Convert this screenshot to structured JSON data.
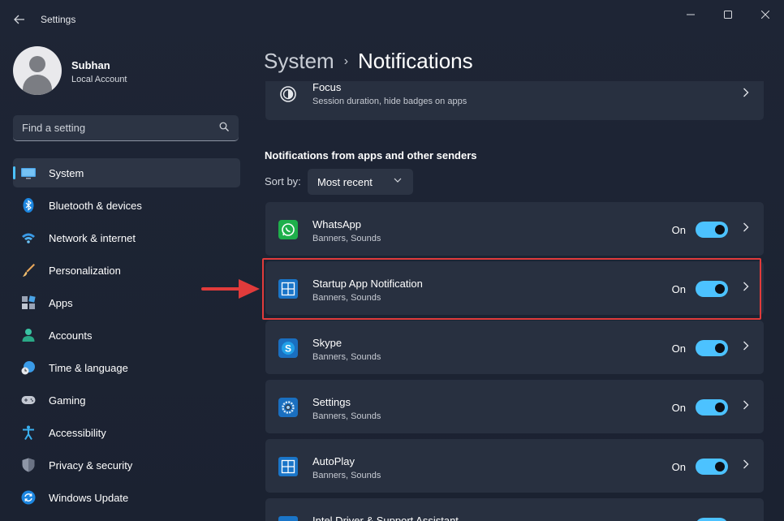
{
  "window": {
    "title": "Settings"
  },
  "profile": {
    "name": "Subhan",
    "account_type": "Local Account"
  },
  "search": {
    "placeholder": "Find a setting"
  },
  "sidebar": {
    "items": [
      {
        "label": "System",
        "icon": "monitor-icon",
        "active": true
      },
      {
        "label": "Bluetooth & devices",
        "icon": "bluetooth-icon"
      },
      {
        "label": "Network & internet",
        "icon": "wifi-icon"
      },
      {
        "label": "Personalization",
        "icon": "brush-icon"
      },
      {
        "label": "Apps",
        "icon": "apps-icon"
      },
      {
        "label": "Accounts",
        "icon": "person-icon"
      },
      {
        "label": "Time & language",
        "icon": "globe-clock-icon"
      },
      {
        "label": "Gaming",
        "icon": "gamepad-icon"
      },
      {
        "label": "Accessibility",
        "icon": "accessibility-icon"
      },
      {
        "label": "Privacy & security",
        "icon": "shield-icon"
      },
      {
        "label": "Windows Update",
        "icon": "update-icon"
      }
    ]
  },
  "header": {
    "parent": "System",
    "separator": "›",
    "current": "Notifications"
  },
  "focus": {
    "title": "Focus",
    "subtitle": "Session duration, hide badges on apps",
    "icon": "focus-icon"
  },
  "senders": {
    "heading": "Notifications from apps and other senders",
    "sort_label": "Sort by:",
    "sort_value": "Most recent",
    "apps": [
      {
        "name": "WhatsApp",
        "detail": "Banners, Sounds",
        "state": "On",
        "icon": "whatsapp-icon",
        "enabled": true
      },
      {
        "name": "Startup App Notification",
        "detail": "Banners, Sounds",
        "state": "On",
        "icon": "startup-app-icon",
        "enabled": true,
        "highlighted": true
      },
      {
        "name": "Skype",
        "detail": "Banners, Sounds",
        "state": "On",
        "icon": "skype-icon",
        "enabled": true
      },
      {
        "name": "Settings",
        "detail": "Banners, Sounds",
        "state": "On",
        "icon": "settings-gear-icon",
        "enabled": true
      },
      {
        "name": "AutoPlay",
        "detail": "Banners, Sounds",
        "state": "On",
        "icon": "autoplay-icon",
        "enabled": true
      },
      {
        "name": "Intel Driver & Support Assistant",
        "detail": "",
        "state": "",
        "icon": "intel-icon",
        "enabled": true
      }
    ]
  },
  "colors": {
    "accent": "#4cc2ff",
    "highlight": "#e13b3b",
    "background": "#1c2333",
    "card": "#283040"
  }
}
